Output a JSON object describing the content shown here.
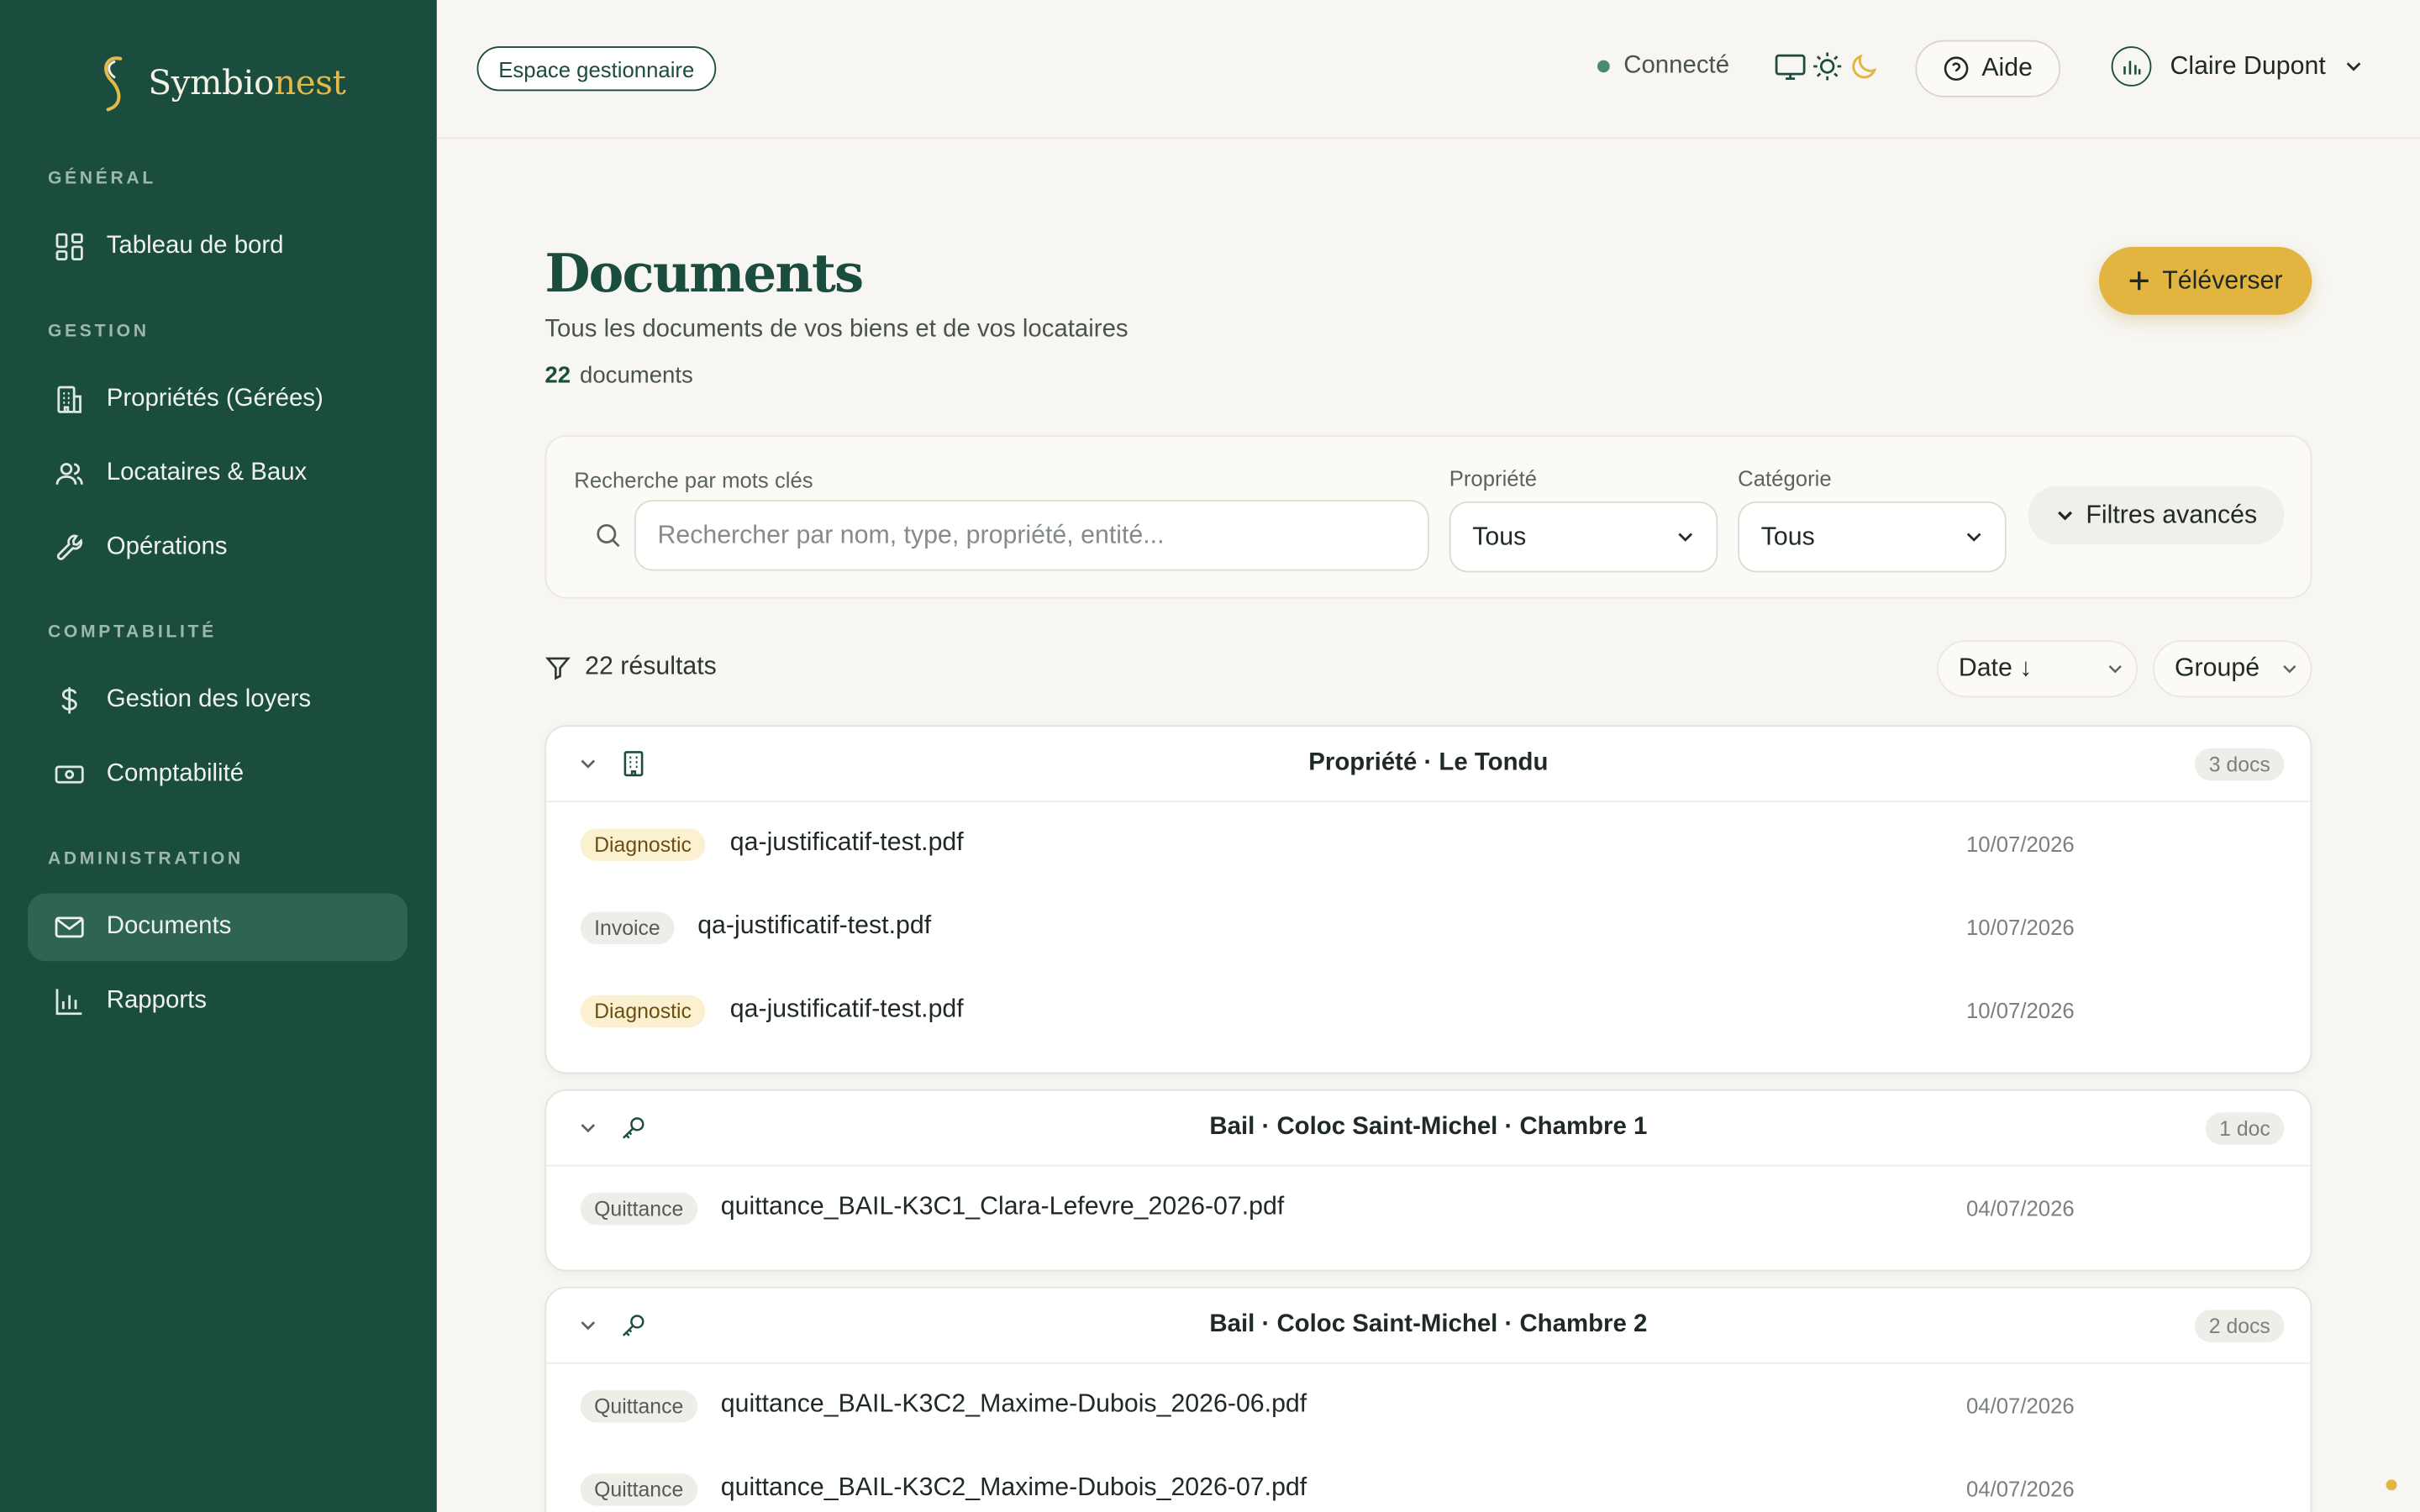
{
  "brand": {
    "name_main": "Symbio",
    "name_accent": "nest"
  },
  "sidebar": {
    "sections": [
      {
        "label": "GÉNÉRAL"
      },
      {
        "label": "GESTION"
      },
      {
        "label": "COMPTABILITÉ"
      },
      {
        "label": "ADMINISTRATION"
      }
    ],
    "items": [
      {
        "label": "Tableau de bord",
        "icon": "dashboard-icon"
      },
      {
        "label": "Propriétés (Gérées)",
        "icon": "building-icon"
      },
      {
        "label": "Locataires & Baux",
        "icon": "users-icon"
      },
      {
        "label": "Opérations",
        "icon": "wrench-icon"
      },
      {
        "label": "Gestion des loyers",
        "icon": "dollar-icon"
      },
      {
        "label": "Comptabilité",
        "icon": "banknote-icon"
      },
      {
        "label": "Documents",
        "icon": "mail-icon",
        "active": true
      },
      {
        "label": "Rapports",
        "icon": "bar-chart-icon"
      }
    ]
  },
  "topbar": {
    "space_label": "Espace gestionnaire",
    "status": "Connecté",
    "help": "Aide",
    "user_name": "Claire Dupont"
  },
  "page": {
    "title": "Documents",
    "subtitle": "Tous les documents de vos biens et de vos locataires",
    "count": "22",
    "count_label": "documents",
    "upload_label": "Téléverser"
  },
  "filters": {
    "search_label": "Recherche par mots clés",
    "search_placeholder": "Rechercher par nom, type, propriété, entité...",
    "property_label": "Propriété",
    "property_value": "Tous",
    "category_label": "Catégorie",
    "category_value": "Tous",
    "advanced_label": "Filtres avancés"
  },
  "results": {
    "label": "22 résultats",
    "sort_value": "Date ↓",
    "group_value": "Groupé"
  },
  "groups": [
    {
      "title": "Propriété · Le Tondu",
      "count": "3 docs",
      "icon": "building-icon",
      "docs": [
        {
          "tag": "Diagnostic",
          "name": "qa-justificatif-test.pdf",
          "date": "10/07/2026"
        },
        {
          "tag": "Invoice",
          "name": "qa-justificatif-test.pdf",
          "date": "10/07/2026"
        },
        {
          "tag": "Diagnostic",
          "name": "qa-justificatif-test.pdf",
          "date": "10/07/2026"
        }
      ]
    },
    {
      "title": "Bail · Coloc Saint-Michel · Chambre 1",
      "count": "1 doc",
      "icon": "key-icon",
      "docs": [
        {
          "tag": "Quittance",
          "name": "quittance_BAIL-K3C1_Clara-Lefevre_2026-07.pdf",
          "date": "04/07/2026"
        }
      ]
    },
    {
      "title": "Bail · Coloc Saint-Michel · Chambre 2",
      "count": "2 docs",
      "icon": "key-icon",
      "docs": [
        {
          "tag": "Quittance",
          "name": "quittance_BAIL-K3C2_Maxime-Dubois_2026-06.pdf",
          "date": "04/07/2026"
        },
        {
          "tag": "Quittance",
          "name": "quittance_BAIL-K3C2_Maxime-Dubois_2026-07.pdf",
          "date": "04/07/2026"
        }
      ]
    }
  ],
  "colors": {
    "sidebar": "#1b4d3e",
    "accent": "#e2b440",
    "active_item": "#2f6453"
  }
}
